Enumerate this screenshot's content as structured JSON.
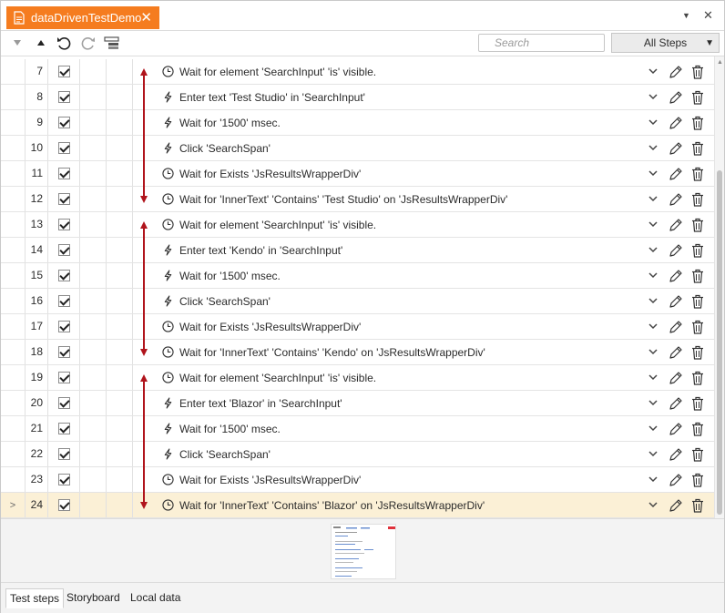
{
  "window": {
    "tab_title": "dataDrivenTestDemo",
    "close_glyph": "✕",
    "menu_glyph": "▼",
    "close_window_glyph": "✕"
  },
  "toolbar": {
    "search_placeholder": "Search",
    "filter_selected": "All Steps"
  },
  "steps": [
    {
      "num": "7",
      "icon": "clock-icon",
      "text": "Wait for element 'SearchInput' 'is' visible."
    },
    {
      "num": "8",
      "icon": "bolt-icon",
      "text": "Enter text 'Test Studio' in 'SearchInput'"
    },
    {
      "num": "9",
      "icon": "bolt-icon",
      "text": "Wait for '1500' msec."
    },
    {
      "num": "10",
      "icon": "bolt-icon",
      "text": "Click 'SearchSpan'"
    },
    {
      "num": "11",
      "icon": "clock-icon",
      "text": "Wait for Exists 'JsResultsWrapperDiv'"
    },
    {
      "num": "12",
      "icon": "clock-icon",
      "text": "Wait for 'InnerText' 'Contains' 'Test Studio' on 'JsResultsWrapperDiv'"
    },
    {
      "num": "13",
      "icon": "clock-icon",
      "text": "Wait for element 'SearchInput' 'is' visible."
    },
    {
      "num": "14",
      "icon": "bolt-icon",
      "text": "Enter text 'Kendo' in 'SearchInput'"
    },
    {
      "num": "15",
      "icon": "bolt-icon",
      "text": "Wait for '1500' msec."
    },
    {
      "num": "16",
      "icon": "bolt-icon",
      "text": "Click 'SearchSpan'"
    },
    {
      "num": "17",
      "icon": "clock-icon",
      "text": "Wait for Exists 'JsResultsWrapperDiv'"
    },
    {
      "num": "18",
      "icon": "clock-icon",
      "text": "Wait for 'InnerText' 'Contains' 'Kendo' on 'JsResultsWrapperDiv'"
    },
    {
      "num": "19",
      "icon": "clock-icon",
      "text": "Wait for element 'SearchInput' 'is' visible."
    },
    {
      "num": "20",
      "icon": "bolt-icon",
      "text": "Enter text 'Blazor' in 'SearchInput'"
    },
    {
      "num": "21",
      "icon": "bolt-icon",
      "text": "Wait for '1500' msec."
    },
    {
      "num": "22",
      "icon": "bolt-icon",
      "text": "Click 'SearchSpan'"
    },
    {
      "num": "23",
      "icon": "clock-icon",
      "text": "Wait for Exists 'JsResultsWrapperDiv'"
    },
    {
      "num": "24",
      "icon": "clock-icon",
      "text": "Wait for 'InnerText' 'Contains' 'Blazor' on 'JsResultsWrapperDiv'",
      "selected": true
    }
  ],
  "bottom_tabs": [
    {
      "label": "Test steps",
      "active": true
    },
    {
      "label": "Storyboard"
    },
    {
      "label": "Local data"
    }
  ],
  "colors": {
    "tab_accent": "#f57c1f",
    "selected_row": "#fbf0d6",
    "annotation_arrow": "#b0141c"
  }
}
